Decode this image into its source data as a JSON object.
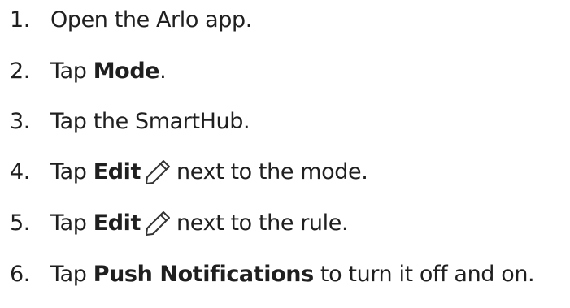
{
  "steps": [
    {
      "number": "1.",
      "text": "Open the Arlo app."
    },
    {
      "number": "2.",
      "pre": "Tap ",
      "bold": "Mode",
      "post": "."
    },
    {
      "number": "3.",
      "text": "Tap the SmartHub."
    },
    {
      "number": "4.",
      "pre": "Tap ",
      "bold": "Edit",
      "icon": "pencil-icon",
      "post": "next to the mode."
    },
    {
      "number": "5.",
      "pre": "Tap ",
      "bold": "Edit",
      "icon": "pencil-icon",
      "post": "next to the rule."
    },
    {
      "number": "6.",
      "pre": "Tap ",
      "bold": "Push Notifications",
      "post": " to turn it off and on."
    }
  ]
}
